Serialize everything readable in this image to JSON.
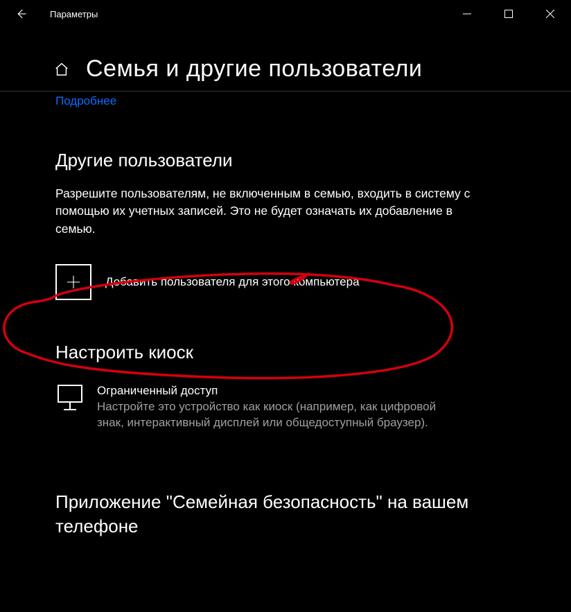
{
  "titlebar": {
    "label": "Параметры"
  },
  "header": {
    "title": "Семья и другие пользователи"
  },
  "more_link": "Подробнее",
  "other_users": {
    "heading": "Другие пользователи",
    "description": "Разрешите пользователям, не включенным в семью, входить в систему с помощью их учетных записей. Это не будет означать их добавление в семью.",
    "add_label": "Добавить пользователя для этого компьютера"
  },
  "kiosk": {
    "heading": "Настроить киоск",
    "title": "Ограниченный доступ",
    "description": "Настройте это устройство как киоск (например, как цифровой знак, интерактивный дисплей или общедоступный браузер)."
  },
  "app_section": {
    "heading": "Приложение \"Семейная безопасность\" на вашем телефоне"
  }
}
